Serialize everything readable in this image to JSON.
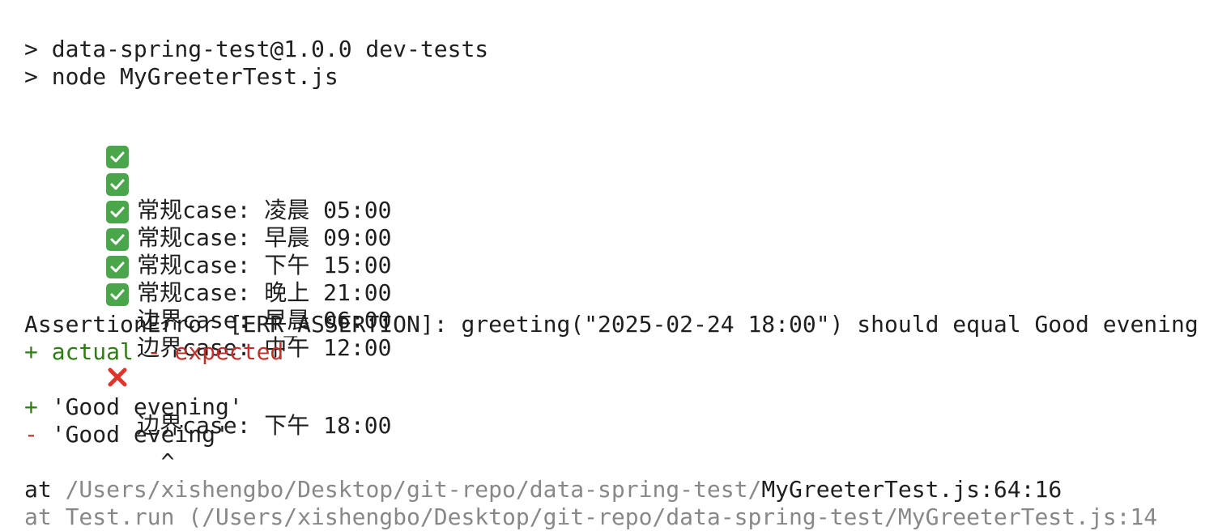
{
  "header": {
    "line1": "> data-spring-test@1.0.0 dev-tests",
    "line2": "> node MyGreeterTest.js"
  },
  "results": [
    {
      "status": "pass",
      "text": "常规case: 凌晨 05:00"
    },
    {
      "status": "pass",
      "text": "常规case: 早晨 09:00"
    },
    {
      "status": "pass",
      "text": "常规case: 下午 15:00"
    },
    {
      "status": "pass",
      "text": "常规case: 晚上 21:00"
    },
    {
      "status": "pass",
      "text": "边界case: 早晨 06:00"
    },
    {
      "status": "pass",
      "text": "边界case: 中午 12:00"
    },
    {
      "status": "fail",
      "text": "边界case: 下午 18:00"
    }
  ],
  "error": {
    "message": "AssertionError [ERR_ASSERTION]: greeting(\"2025-02-24 18:00\") should equal Good evening",
    "legend_plus": "+ actual",
    "legend_minus": "- expected",
    "actual_line": "+ 'Good evening'",
    "expected_line": "- 'Good eveing'",
    "caret": "^",
    "stack1_prefix": "at ",
    "stack1_path": "/Users/xishengbo/Desktop/git-repo/data-spring-test/",
    "stack1_file": "MyGreeterTest.js:64:16",
    "stack2_partial": "at Test.run (/Users/xishengbo/Desktop/git-repo/data-spring-test/MyGreeterTest.js:14"
  },
  "icons": {
    "pass": "check-mark-icon",
    "fail": "cross-mark-icon"
  },
  "colors": {
    "green": "#2e7d14",
    "red": "#c0302a",
    "pass_icon_bg": "#4aa64a"
  }
}
